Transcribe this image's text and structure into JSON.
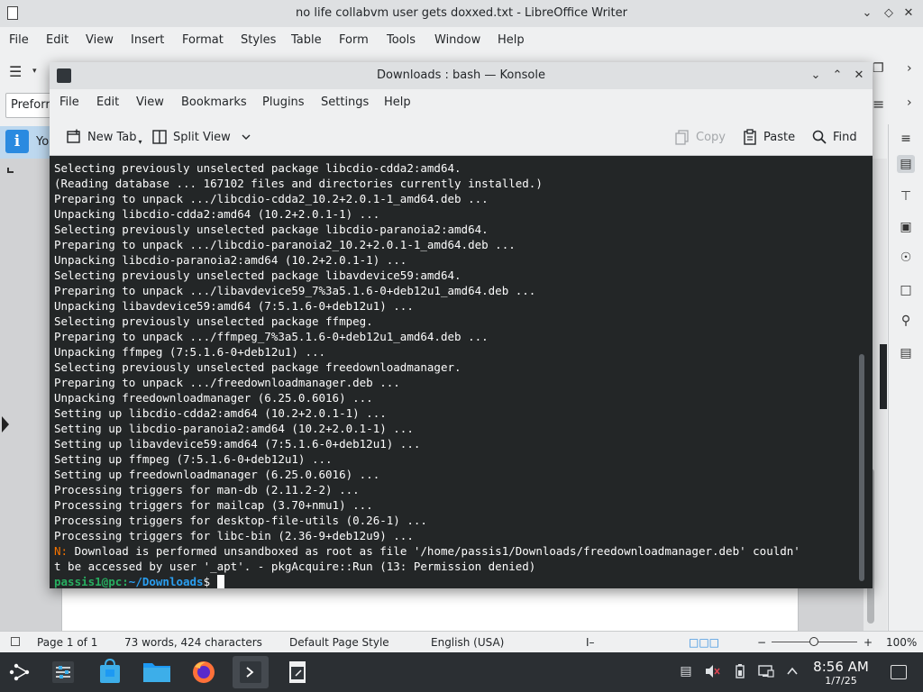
{
  "writer": {
    "title": "no life collabvm user gets doxxed.txt - LibreOffice Writer",
    "menu": [
      "File",
      "Edit",
      "View",
      "Insert",
      "Format",
      "Styles",
      "Table",
      "Form",
      "Tools",
      "Window",
      "Help"
    ],
    "paragraph_style": "Preforr",
    "infobar_text": "Yo",
    "status": {
      "page": "Page 1 of 1",
      "words": "73 words, 424 characters",
      "page_style": "Default Page Style",
      "language": "English (USA)",
      "zoom_minus": "−",
      "zoom_plus": "+",
      "zoom_level": "100%"
    }
  },
  "konsole": {
    "title": "Downloads : bash — Konsole",
    "menu": [
      "File",
      "Edit",
      "View",
      "Bookmarks",
      "Plugins",
      "Settings",
      "Help"
    ],
    "toolbar": {
      "new_tab": "New Tab",
      "split_view": "Split View",
      "copy": "Copy",
      "paste": "Paste",
      "find": "Find"
    },
    "terminal": {
      "lines": [
        "Selecting previously unselected package libcdio-cdda2:amd64.",
        "(Reading database ... 167102 files and directories currently installed.)",
        "Preparing to unpack .../libcdio-cdda2_10.2+2.0.1-1_amd64.deb ...",
        "Unpacking libcdio-cdda2:amd64 (10.2+2.0.1-1) ...",
        "Selecting previously unselected package libcdio-paranoia2:amd64.",
        "Preparing to unpack .../libcdio-paranoia2_10.2+2.0.1-1_amd64.deb ...",
        "Unpacking libcdio-paranoia2:amd64 (10.2+2.0.1-1) ...",
        "Selecting previously unselected package libavdevice59:amd64.",
        "Preparing to unpack .../libavdevice59_7%3a5.1.6-0+deb12u1_amd64.deb ...",
        "Unpacking libavdevice59:amd64 (7:5.1.6-0+deb12u1) ...",
        "Selecting previously unselected package ffmpeg.",
        "Preparing to unpack .../ffmpeg_7%3a5.1.6-0+deb12u1_amd64.deb ...",
        "Unpacking ffmpeg (7:5.1.6-0+deb12u1) ...",
        "Selecting previously unselected package freedownloadmanager.",
        "Preparing to unpack .../freedownloadmanager.deb ...",
        "Unpacking freedownloadmanager (6.25.0.6016) ...",
        "Setting up libcdio-cdda2:amd64 (10.2+2.0.1-1) ...",
        "Setting up libcdio-paranoia2:amd64 (10.2+2.0.1-1) ...",
        "Setting up libavdevice59:amd64 (7:5.1.6-0+deb12u1) ...",
        "Setting up ffmpeg (7:5.1.6-0+deb12u1) ...",
        "Setting up freedownloadmanager (6.25.0.6016) ...",
        "Processing triggers for man-db (2.11.2-2) ...",
        "Processing triggers for mailcap (3.70+nmu1) ...",
        "Processing triggers for desktop-file-utils (0.26-1) ...",
        "Processing triggers for libc-bin (2.36-9+deb12u9) ..."
      ],
      "warn_prefix": "N:",
      "warn_line1": " Download is performed unsandboxed as root as file '/home/passis1/Downloads/freedownloadmanager.deb' couldn'",
      "warn_line2": "t be accessed by user '_apt'. - pkgAcquire::Run (13: Permission denied)",
      "prompt_user": "passis1@pc",
      "prompt_colon": ":",
      "prompt_path": "~/Downloads",
      "prompt_symbol": "$ "
    }
  },
  "taskbar": {
    "time": "8:56 AM",
    "date": "1/7/25"
  }
}
